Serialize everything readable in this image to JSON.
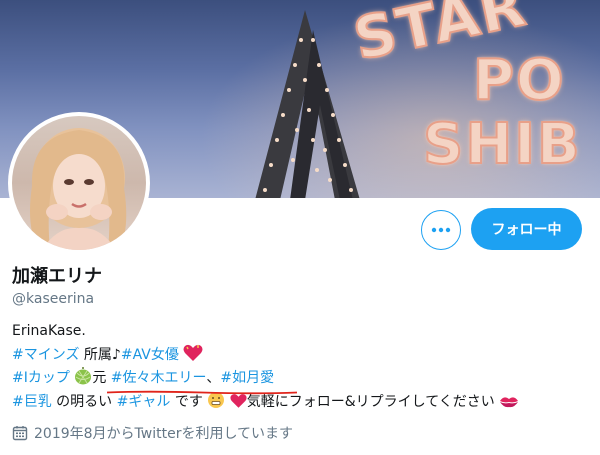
{
  "banner": {
    "sign_words": [
      "STAR",
      "PO",
      "SHIB"
    ]
  },
  "profile": {
    "name": "加瀬エリナ",
    "handle": "@kaseerina",
    "follow_label": "フォロー中",
    "joined": "2019年8月からTwitterを利用しています"
  },
  "bio": {
    "line1": "ErinaKase.",
    "line2": {
      "tag1": "#マインズ",
      "text1": " 所属♪",
      "tag2": "#AV女優"
    },
    "line3": {
      "tag1": "#Iカップ",
      "text1": "元",
      "tag2": "#佐々木エリー",
      "text2": "、",
      "tag3": "#如月愛"
    },
    "line4": {
      "tag1": "#巨乳",
      "text1": " の明るい ",
      "tag2": "#ギャル",
      "text2": " です",
      "text3": "気軽にフォロー&リプライしてください"
    }
  },
  "colors": {
    "accent": "#1da1f2",
    "link": "#1b95e0",
    "muted": "#657786",
    "annotation": "#e0241b"
  },
  "icons": [
    "more-horizontal-icon",
    "calendar-icon",
    "heart-emoji",
    "melon-emoji",
    "grimace-emoji",
    "kiss-emoji"
  ]
}
